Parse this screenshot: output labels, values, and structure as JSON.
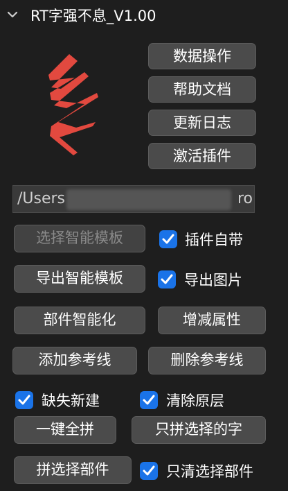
{
  "panel": {
    "title": "RT字强不息_V1.00"
  },
  "logo": {
    "color": "#e2493f"
  },
  "top_buttons": {
    "data_ops": "数据操作",
    "help_docs": "帮助文档",
    "update_log": "更新日志",
    "activate_plugin": "激活插件"
  },
  "path_field": {
    "value_prefix": "/Users",
    "value_suffix": "ro"
  },
  "templates": {
    "select_smart_template": "选择智能模板",
    "plugin_builtin_label": "插件自带",
    "plugin_builtin_checked": true,
    "export_smart_template": "导出智能模板",
    "export_image_label": "导出图片",
    "export_image_checked": true
  },
  "components": {
    "component_smart": "部件智能化",
    "add_remove_attrs": "增减属性",
    "add_guides": "添加参考线",
    "delete_guides": "删除参考线"
  },
  "options": {
    "missing_new_label": "缺失新建",
    "missing_new_checked": true,
    "clear_original_label": "清除原层",
    "clear_original_checked": true
  },
  "assemble": {
    "one_click_all": "一键全拼",
    "only_selected_chars": "只拼选择的字",
    "assemble_selected_parts": "拼选择部件",
    "only_clear_selected_label": "只清选择部件",
    "only_clear_selected_checked": true
  },
  "colors": {
    "checkbox": "#1a73e8",
    "button": "#4b4b4b",
    "background": "#1e1e1e"
  }
}
